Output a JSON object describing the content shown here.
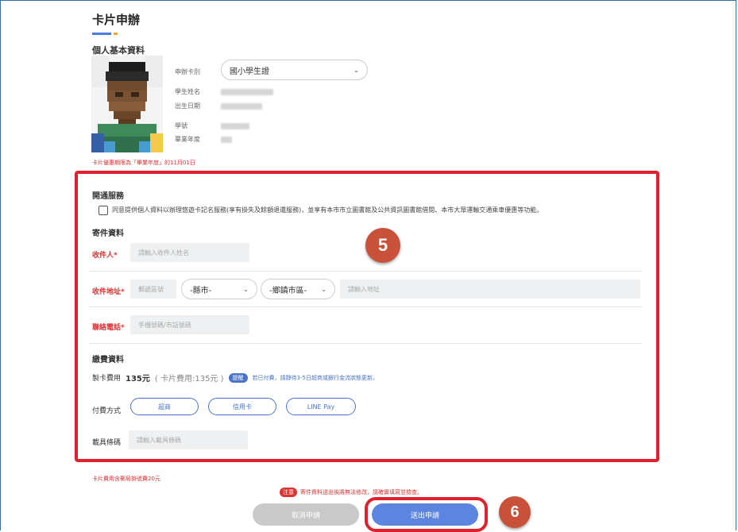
{
  "page": {
    "title": "卡片申辦",
    "section_basic": "個人基本資料"
  },
  "basic": {
    "labels": {
      "card_type": "申辦卡別",
      "student_name": "學生姓名",
      "birth_date": "出生日期",
      "student_no": "學號",
      "grad_year": "畢業年度"
    },
    "card_type_value": "國小學生證",
    "validity_note": "卡片優惠期限為「畢業年度」的11月01日"
  },
  "service": {
    "heading": "開通服務",
    "consent_text": "同意提供個人資料以辦理悠遊卡記名服務(享有掛失及餘額退還服務)，並享有本市市立圖書館及公共資訊圖書館借閱、本市大眾運輸交通乘車優惠等功能。"
  },
  "mailing": {
    "heading": "寄件資料",
    "recipient_label": "收件人",
    "required_mark": "*",
    "recipient_placeholder": "請輸入收件人姓名",
    "address_label": "收件地址",
    "postal_placeholder": "郵遞區號",
    "county_value": "-縣市-",
    "district_value": "-鄉鎮市區-",
    "address_placeholder": "請輸入地址",
    "phone_label": "聯絡電話",
    "phone_placeholder": "手機號碼/市話號碼"
  },
  "payment": {
    "heading": "繳費資料",
    "fee_label": "製卡費用",
    "fee_value": "135元",
    "fee_detail": "( 卡片費用:135元 )",
    "tip_badge": "提醒",
    "tip_text": "若已付費，請靜待3-5日超商或銀行金流狀態更新。",
    "method_label": "付費方式",
    "methods": [
      "超商",
      "信用卡",
      "LINE Pay"
    ],
    "carrier_label": "載具條碼",
    "carrier_placeholder": "請輸入載具條碼"
  },
  "footer": {
    "shipping_note": "卡片費用含郵局掛號費20元",
    "notice_badge": "注意",
    "notice_text": "寄件資料送出後將無法修改，請確實填寫並檢查。",
    "cancel_label": "取消申請",
    "submit_label": "送出申請"
  },
  "annotations": {
    "step5": "5",
    "step6": "6"
  },
  "colors": {
    "accent": "#4a74c9",
    "highlight": "#e0202c",
    "badge": "#c9513a",
    "required": "#d33333"
  }
}
